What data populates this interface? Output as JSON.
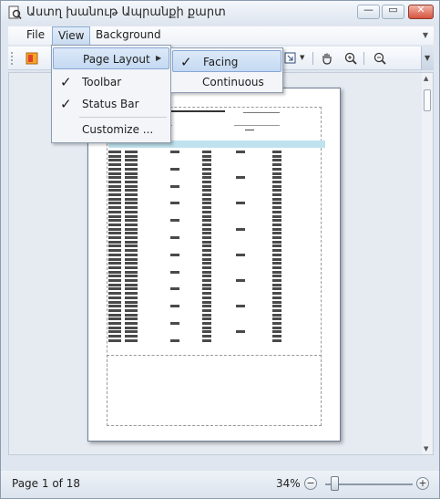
{
  "window": {
    "title": "Աստղ խանութ Ապրանքի քարտ",
    "minimize_glyph": "—",
    "maximize_glyph": "▭",
    "close_glyph": "✕"
  },
  "menubar": {
    "items": [
      {
        "label": "File"
      },
      {
        "label": "View"
      },
      {
        "label": "Background"
      }
    ],
    "overflow_glyph": "▼"
  },
  "toolbar": {
    "icons": [
      "document-map-icon",
      "zoom-page-icon",
      "hand-tool-icon",
      "zoom-in-icon",
      "zoom-out-icon"
    ],
    "dropdown_glyph": "▼"
  },
  "view_menu": {
    "items": [
      {
        "label": "Page Layout",
        "has_submenu": true,
        "checked": false
      },
      {
        "label": "Toolbar",
        "checked": true
      },
      {
        "label": "Status Bar",
        "checked": true
      },
      {
        "label": "Customize ...",
        "checked": false
      }
    ],
    "check_glyph": "✓",
    "submenu_glyph": "▶"
  },
  "page_layout_submenu": {
    "items": [
      {
        "label": "Facing",
        "checked": true
      },
      {
        "label": "Continuous",
        "checked": false
      }
    ]
  },
  "statusbar": {
    "page_info": "Page 1 of 18",
    "zoom": "34%",
    "zoom_out_glyph": "−",
    "zoom_in_glyph": "+"
  },
  "colors": {
    "accent": "#c4d9f2",
    "table_header": "#bfe3ee"
  }
}
